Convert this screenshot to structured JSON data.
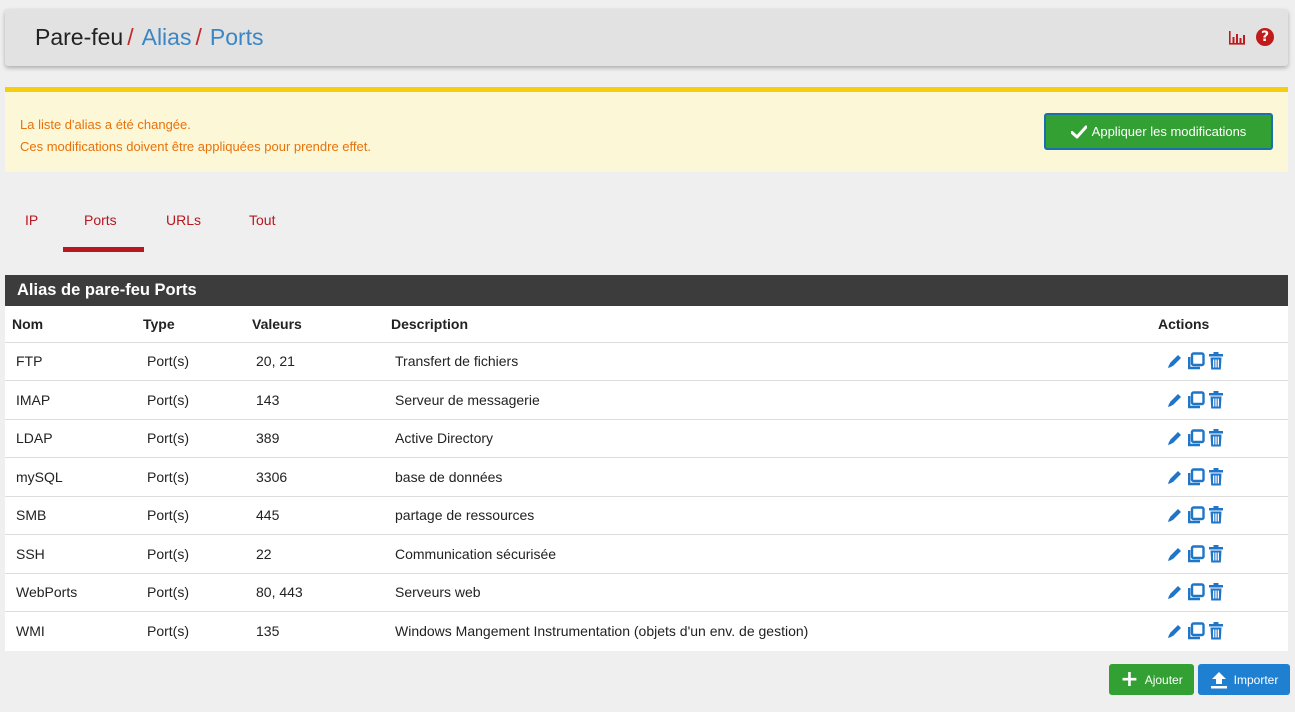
{
  "breadcrumb": {
    "root": "Pare-feu",
    "level1": "Alias",
    "level2": "Ports",
    "separator": "/"
  },
  "header_icons": [
    "chart-icon",
    "help-icon"
  ],
  "alert": {
    "line1": "La liste d'alias a été changée.",
    "line2": "Ces modifications doivent être appliquées pour prendre effet.",
    "apply_label": "Appliquer les modifications"
  },
  "tabs": [
    {
      "label": "IP",
      "active": false
    },
    {
      "label": "Ports",
      "active": true
    },
    {
      "label": "URLs",
      "active": false
    },
    {
      "label": "Tout",
      "active": false
    }
  ],
  "panel": {
    "title": "Alias de pare-feu Ports",
    "columns": [
      "Nom",
      "Type",
      "Valeurs",
      "Description",
      "Actions"
    ],
    "rows": [
      {
        "name": "FTP",
        "type": "Port(s)",
        "values": "20, 21",
        "description": "Transfert de fichiers"
      },
      {
        "name": "IMAP",
        "type": "Port(s)",
        "values": "143",
        "description": "Serveur de messagerie"
      },
      {
        "name": "LDAP",
        "type": "Port(s)",
        "values": "389",
        "description": "Active Directory"
      },
      {
        "name": "mySQL",
        "type": "Port(s)",
        "values": "3306",
        "description": "base de données"
      },
      {
        "name": "SMB",
        "type": "Port(s)",
        "values": "445",
        "description": "partage de ressources"
      },
      {
        "name": "SSH",
        "type": "Port(s)",
        "values": "22",
        "description": "Communication sécurisée"
      },
      {
        "name": "WebPorts",
        "type": "Port(s)",
        "values": "80, 443",
        "description": "Serveurs web"
      },
      {
        "name": "WMI",
        "type": "Port(s)",
        "values": "135",
        "description": "Windows Mangement Instrumentation (objets d'un env. de gestion)"
      }
    ]
  },
  "buttons": {
    "add_label": "Ajouter",
    "import_label": "Importer"
  },
  "colors": {
    "accent_red": "#b8171f",
    "link_blue": "#3b86c4",
    "success_green": "#33a033",
    "primary_blue": "#1f7fd1",
    "alert_orange": "#e8720c",
    "alert_bg": "#fcf7d7"
  }
}
